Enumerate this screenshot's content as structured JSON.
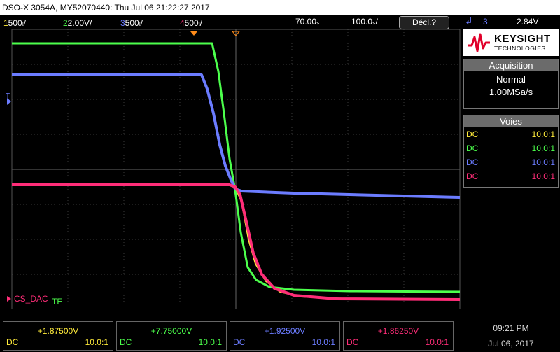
{
  "title": "DSO-X 3054A, MY52070440: Thu Jul 06 21:22:27 2017",
  "channels": [
    {
      "num": "1",
      "scale": "500ₗ/"
    },
    {
      "num": "2",
      "scale": "2.00V/"
    },
    {
      "num": "3",
      "scale": "500ₗ/"
    },
    {
      "num": "4",
      "scale": "500ₗ/"
    }
  ],
  "timebase": {
    "delay": "70.00ₛ",
    "scale": "100.0ₛ/",
    "mode": "Décl.?"
  },
  "trigger": {
    "icon": "trigger-edge-icon",
    "channel": "3",
    "level": "2.84V"
  },
  "brand": {
    "name": "KEYSIGHT",
    "sub": "TECHNOLOGIES"
  },
  "acquisition": {
    "title": "Acquisition",
    "mode": "Normal",
    "rate": "1.00MSa/s"
  },
  "voies": {
    "title": "Voies",
    "rows": [
      {
        "coupling": "DC",
        "probe": "10.0:1",
        "color": "#ffeb3b"
      },
      {
        "coupling": "DC",
        "probe": "10.0:1",
        "color": "#4cff4c"
      },
      {
        "coupling": "DC",
        "probe": "10.0:1",
        "color": "#6b7cff"
      },
      {
        "coupling": "DC",
        "probe": "10.0:1",
        "color": "#ff2d78"
      }
    ]
  },
  "labels": {
    "cs_dac": "CS_DAC",
    "te": "TE",
    "t_marker": "T"
  },
  "bottom": [
    {
      "value": "+1.87500V",
      "coupling": "DC",
      "probe": "10.0:1",
      "color": "#ffeb3b"
    },
    {
      "value": "+7.75000V",
      "coupling": "DC",
      "probe": "10.0:1",
      "color": "#4cff4c"
    },
    {
      "value": "+1.92500V",
      "coupling": "DC",
      "probe": "10.0:1",
      "color": "#6b7cff"
    },
    {
      "value": "+1.86250V",
      "coupling": "DC",
      "probe": "10.0:1",
      "color": "#ff2d78"
    }
  ],
  "clock": {
    "time": "09:21 PM",
    "date": "Jul 06, 2017"
  }
}
